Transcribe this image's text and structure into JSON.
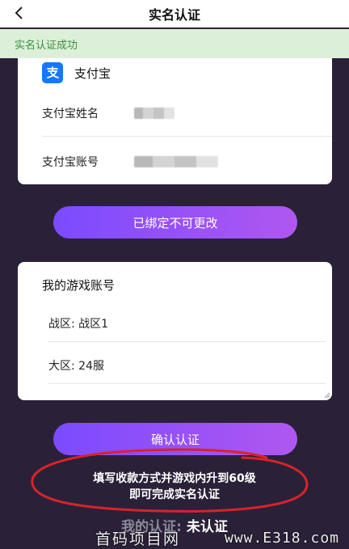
{
  "header": {
    "title": "实名认证",
    "back_icon": "chevron-left-icon"
  },
  "success_bar": {
    "text": "实名认证成功"
  },
  "payment": {
    "provider_name": "支付宝",
    "provider_icon": "alipay-logo",
    "fields": [
      {
        "label": "支付宝姓名",
        "value_masked": true
      },
      {
        "label": "支付宝账号",
        "value_masked": true
      }
    ],
    "bound_button": "已绑定不可更改"
  },
  "game_account": {
    "title": "我的游戏账号",
    "rows": [
      "战区: 战区1",
      "大区: 24服"
    ]
  },
  "confirm_button": "确认认证",
  "hint": {
    "line1": "填写收款方式并游戏内升到60级",
    "line2": "即可完成实名认证"
  },
  "status": {
    "label": "我的认证:",
    "value": "未认证"
  },
  "watermark": {
    "left": "首码项目网",
    "right": "www.E318.com"
  },
  "colors": {
    "background": "#2a2138",
    "success_bg": "#dcefd9",
    "success_text": "#3c8f3c",
    "button_start": "#7b4bff",
    "button_end": "#b057f0",
    "alipay_blue": "#1677ff",
    "annotation_red": "#d8232a"
  }
}
